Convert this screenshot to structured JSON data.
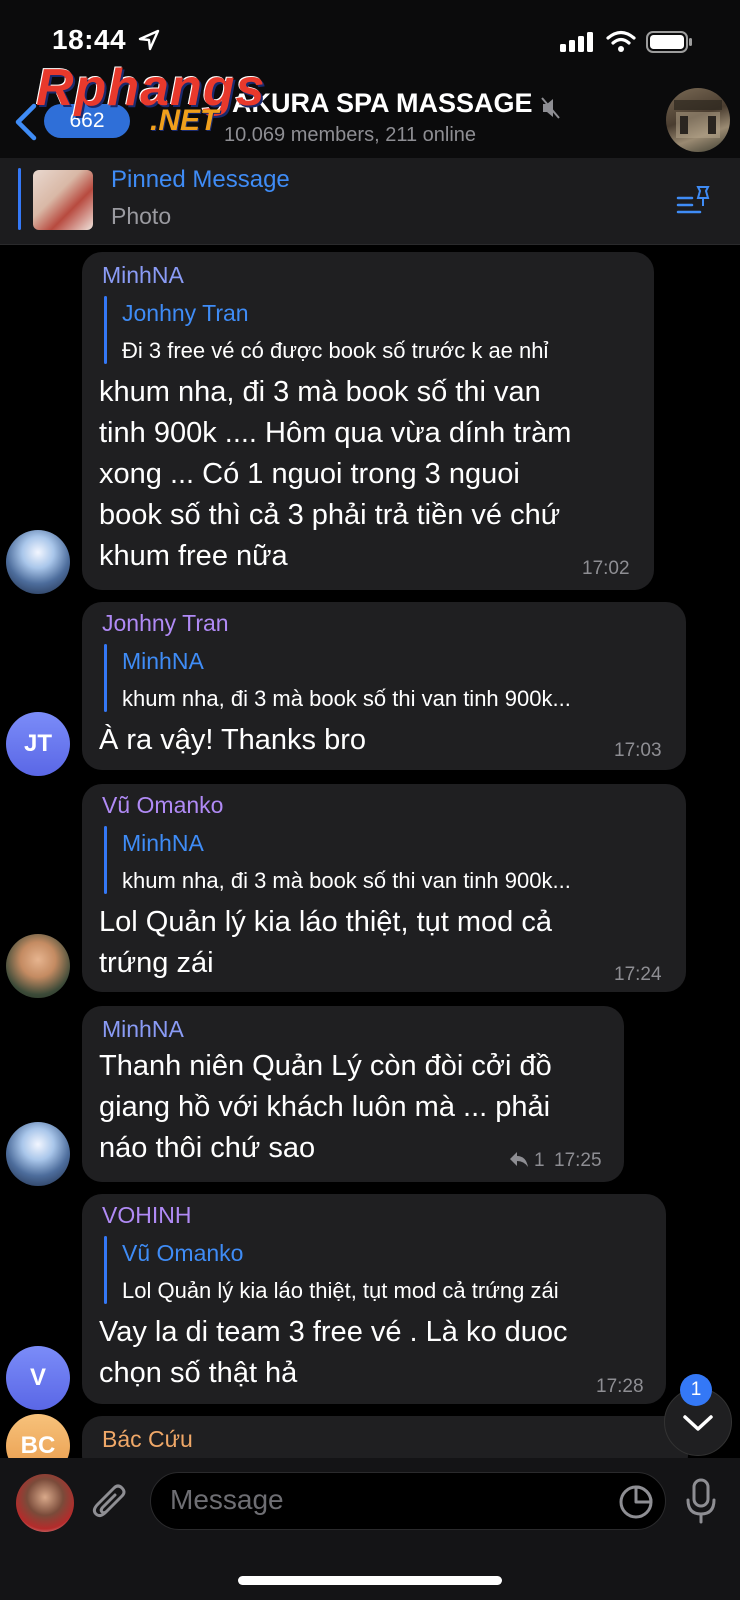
{
  "status_bar": {
    "time": "18:44"
  },
  "header": {
    "back_count": "662",
    "title": "AKURA SPA MASSAGE",
    "subtitle": "10.069 members, 211 online",
    "watermark_main": "Rphangs",
    "watermark_suffix": ".NET"
  },
  "pinned": {
    "title": "Pinned Message",
    "subtitle": "Photo"
  },
  "messages": [
    {
      "sender": "MinhNA",
      "sender_color": "#8a9bf5",
      "reply_name": "Jonhny Tran",
      "reply_text": "Đi 3 free vé có được book số trước k ae nhỉ",
      "lines": [
        "khum nha, đi 3 mà book số thi van",
        "tinh 900k .... Hôm qua vừa dính tràm",
        "xong ... Có 1 nguoi trong 3 nguoi",
        "book số thì cả 3 phải trả tiền vé chứ",
        "khum free nữa"
      ],
      "time": "17:02"
    },
    {
      "sender": "Jonhny Tran",
      "sender_color": "#b08af5",
      "avatar_initials": "JT",
      "reply_name": "MinhNA",
      "reply_text": "khum nha, đi 3 mà book số thi van tinh 900k...",
      "lines": [
        "À ra vậy! Thanks bro"
      ],
      "time": "17:03"
    },
    {
      "sender": "Vũ Omanko",
      "sender_color": "#b08af5",
      "reply_name": "MinhNA",
      "reply_text": "khum nha, đi 3 mà book số thi van tinh 900k...",
      "lines": [
        "Lol Quản lý kia láo thiệt, tụt mod cả",
        "trứng zái"
      ],
      "time": "17:24"
    },
    {
      "sender": "MinhNA",
      "sender_color": "#8a9bf5",
      "lines": [
        "Thanh niên Quản Lý còn đòi cởi đồ",
        "giang hồ với khách luôn mà ... phải",
        "náo thôi chứ sao"
      ],
      "reply_count": "1",
      "time": "17:25"
    },
    {
      "sender": "VOHINH",
      "sender_color": "#b08af5",
      "avatar_initials": "V",
      "reply_name": "Vũ Omanko",
      "reply_text": "Lol Quản lý kia láo thiệt, tụt mod cả trứng zái",
      "lines": [
        "Vay la di team 3 free vé . Là ko duoc",
        "chọn số thật hả"
      ],
      "time": "17:28"
    },
    {
      "sender": "Bác Cứu",
      "sender_color": "#f0a868",
      "avatar_initials": "BC"
    }
  ],
  "scroll_down_badge": "1",
  "input": {
    "placeholder": "Message"
  },
  "colors": {
    "accent": "#3478f6",
    "bubble": "#1f1f21",
    "background": "#000000"
  }
}
